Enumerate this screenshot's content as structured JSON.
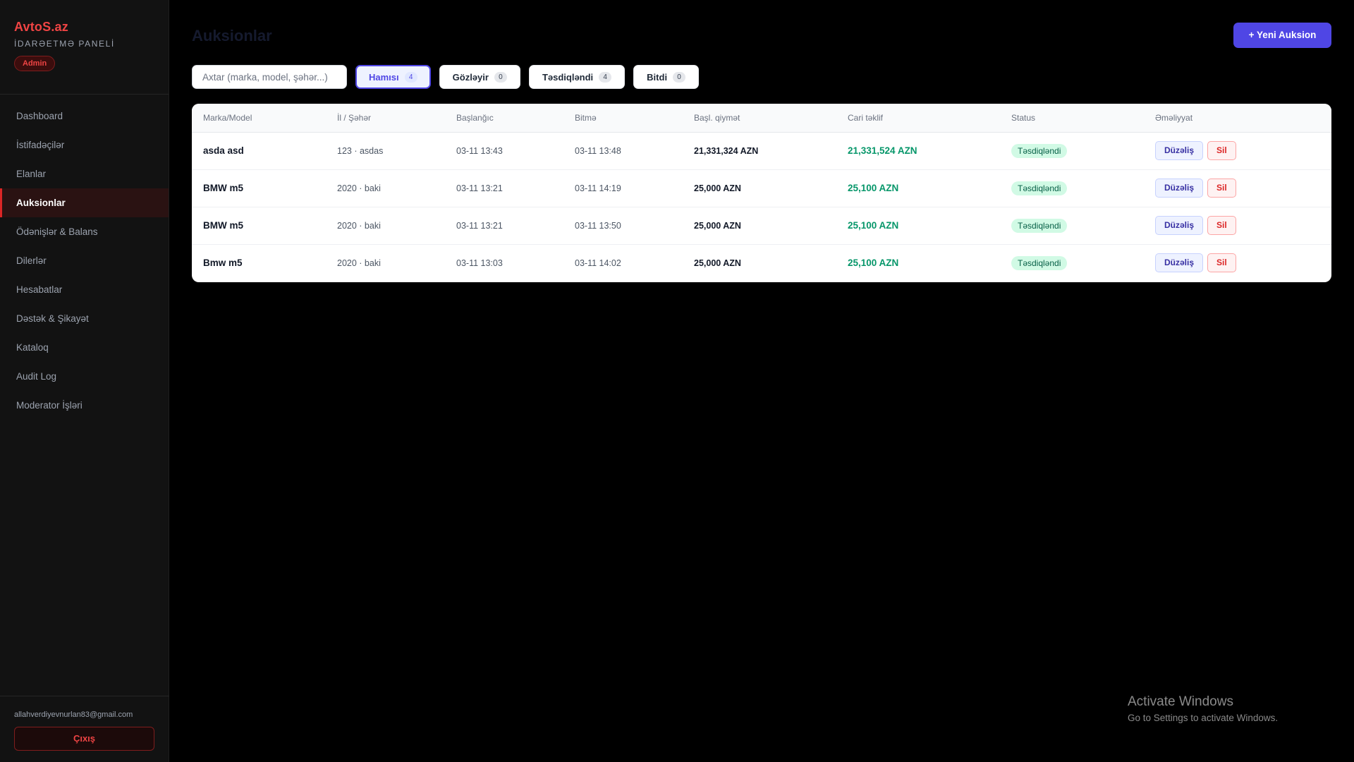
{
  "sidebar": {
    "brand": "AvtoS.az",
    "subtitle": "İDARƏETMƏ PANELİ",
    "role_badge": "Admin",
    "items": [
      {
        "label": "Dashboard"
      },
      {
        "label": "İstifadəçilər"
      },
      {
        "label": "Elanlar"
      },
      {
        "label": "Auksionlar"
      },
      {
        "label": "Ödənişlər & Balans"
      },
      {
        "label": "Dilerlər"
      },
      {
        "label": "Hesabatlar"
      },
      {
        "label": "Dəstək & Şikayət"
      },
      {
        "label": "Kataloq"
      },
      {
        "label": "Audit Log"
      },
      {
        "label": "Moderator İşləri"
      }
    ],
    "active_item": "Auksionlar",
    "user_email": "allahverdiyevnurlan83@gmail.com",
    "logout_label": "Çıxış"
  },
  "main": {
    "title": "Auksionlar",
    "new_button": "+ Yeni Auksion",
    "search_placeholder": "Axtar (marka, model, şəhər...)",
    "filters": [
      {
        "label": "Hamısı",
        "count": "4",
        "active": true
      },
      {
        "label": "Gözləyir",
        "count": "0",
        "active": false
      },
      {
        "label": "Təsdiqləndi",
        "count": "4",
        "active": false
      },
      {
        "label": "Bitdi",
        "count": "0",
        "active": false
      }
    ],
    "table": {
      "columns": [
        "Marka/Model",
        "İl / Şəhər",
        "Başlanğıc",
        "Bitmə",
        "Başl. qiymət",
        "Cari təklif",
        "Status",
        "Əməliyyat"
      ],
      "rows": [
        {
          "model": "asda asd",
          "year_city": "123 · asdas",
          "start": "03-11 13:43",
          "end": "03-11 13:48",
          "start_price": "21,331,324 AZN",
          "current_bid": "21,331,524 AZN",
          "status": "Təsdiqləndi"
        },
        {
          "model": "BMW m5",
          "year_city": "2020 · baki",
          "start": "03-11 13:21",
          "end": "03-11 14:19",
          "start_price": "25,000 AZN",
          "current_bid": "25,100 AZN",
          "status": "Təsdiqləndi"
        },
        {
          "model": "BMW m5",
          "year_city": "2020 · baki",
          "start": "03-11 13:21",
          "end": "03-11 13:50",
          "start_price": "25,000 AZN",
          "current_bid": "25,100 AZN",
          "status": "Təsdiqləndi"
        },
        {
          "model": "Bmw m5",
          "year_city": "2020 · baki",
          "start": "03-11 13:03",
          "end": "03-11 14:02",
          "start_price": "25,000 AZN",
          "current_bid": "25,100 AZN",
          "status": "Təsdiqləndi"
        }
      ],
      "edit_label": "Düzəliş",
      "delete_label": "Sil"
    }
  },
  "watermark": {
    "title": "Activate Windows",
    "subtitle": "Go to Settings to activate Windows."
  },
  "colors": {
    "accent": "#4f46e5",
    "brand_red": "#ef4444",
    "success_green": "#059669"
  }
}
